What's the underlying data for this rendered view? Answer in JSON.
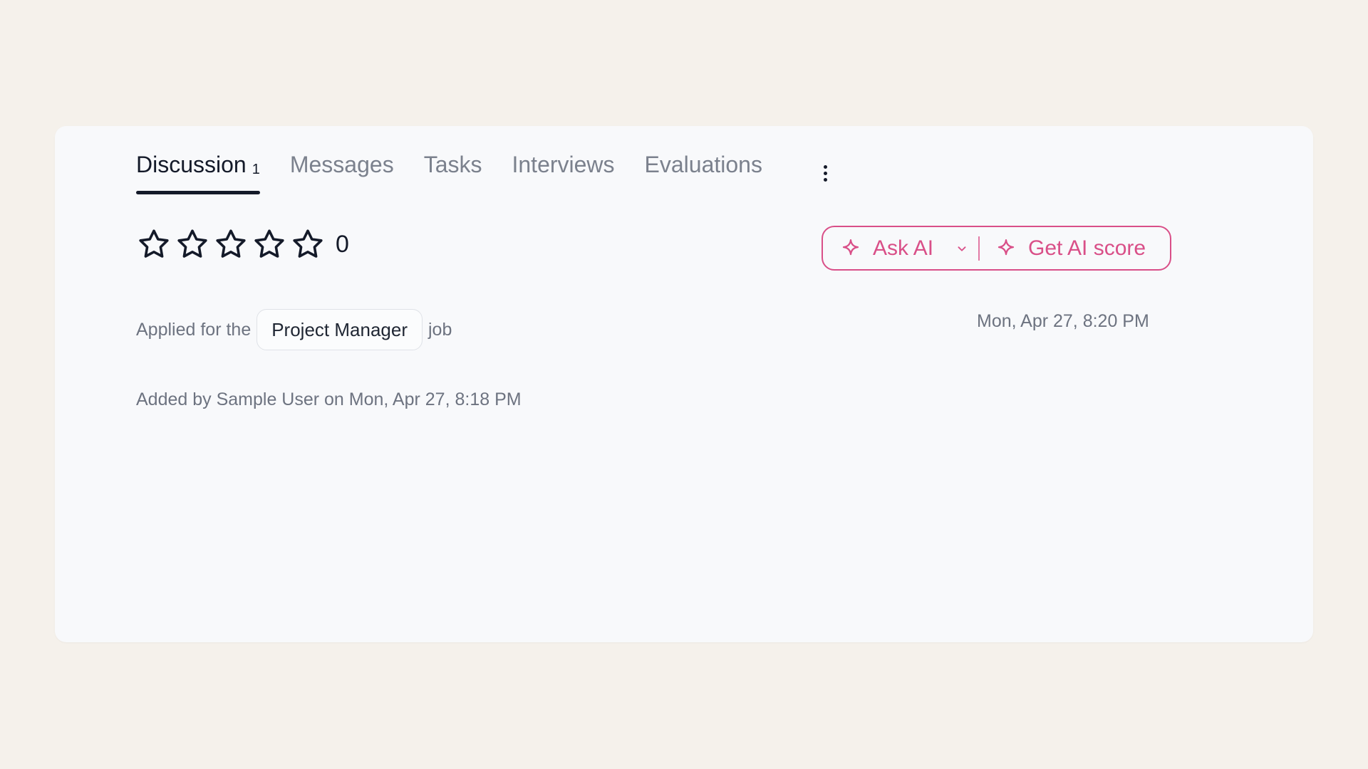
{
  "tabs": [
    {
      "label": "Discussion",
      "count": "1",
      "active": true
    },
    {
      "label": "Messages"
    },
    {
      "label": "Tasks"
    },
    {
      "label": "Interviews"
    },
    {
      "label": "Evaluations"
    }
  ],
  "rating": {
    "value": "0",
    "max_stars": 5,
    "filled_stars": 0
  },
  "ai_actions": {
    "ask_ai_label": "Ask AI",
    "get_score_label": "Get AI score",
    "accent_color": "#d94f88"
  },
  "application": {
    "prefix": "Applied for the",
    "job_title": "Project Manager",
    "suffix": "job",
    "timestamp": "Mon, Apr 27, 8:20 PM"
  },
  "activity": {
    "added_by": "Added by Sample User on Mon, Apr 27, 8:18 PM"
  },
  "icons": {
    "star": "star-outline-icon",
    "sparkle": "sparkle-icon",
    "chevron": "chevron-down-icon",
    "more": "kebab-menu-icon"
  }
}
